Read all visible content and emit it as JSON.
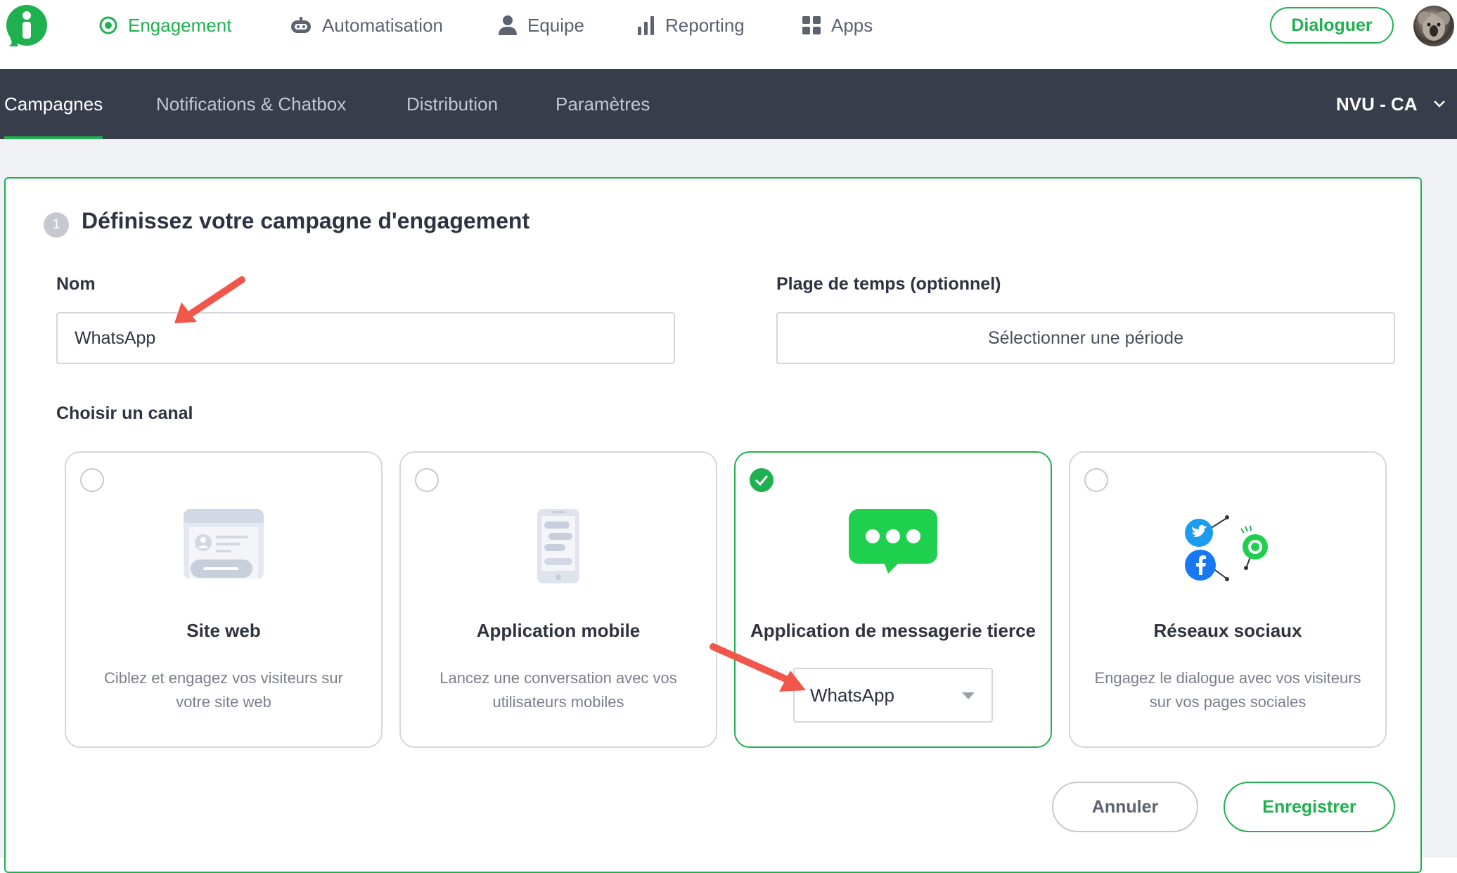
{
  "topnav": {
    "items": [
      {
        "label": "Engagement",
        "icon": "target-icon",
        "active": true
      },
      {
        "label": "Automatisation",
        "icon": "robot-icon",
        "active": false
      },
      {
        "label": "Equipe",
        "icon": "user-icon",
        "active": false
      },
      {
        "label": "Reporting",
        "icon": "bar-chart-icon",
        "active": false
      },
      {
        "label": "Apps",
        "icon": "grid-icon",
        "active": false
      }
    ],
    "cta_label": "Dialoguer"
  },
  "subnav": {
    "tabs": [
      {
        "label": "Campagnes",
        "active": true
      },
      {
        "label": "Notifications & Chatbox",
        "active": false
      },
      {
        "label": "Distribution",
        "active": false
      },
      {
        "label": "Paramètres",
        "active": false
      }
    ],
    "account": "NVU - CA"
  },
  "form": {
    "step_number": "1",
    "title": "Définissez votre campagne d'engagement",
    "name_label": "Nom",
    "name_value": "WhatsApp",
    "period_label": "Plage de temps (optionnel)",
    "period_button": "Sélectionner une période",
    "channel_label": "Choisir un canal",
    "channels": [
      {
        "title": "Site web",
        "description": "Ciblez et engagez vos visiteurs sur votre site web",
        "selected": false,
        "icon": "webpage-icon"
      },
      {
        "title": "Application mobile",
        "description": "Lancez une conversation avec vos utilisateurs mobiles",
        "selected": false,
        "icon": "mobile-phone-icon"
      },
      {
        "title": "Application de messagerie tierce",
        "selected": true,
        "icon": "chat-bubble-icon",
        "select_value": "WhatsApp"
      },
      {
        "title": "Réseaux sociaux",
        "description": "Engagez le dialogue avec vos visiteurs sur vos pages sociales",
        "selected": false,
        "icon": "social-networks-icon"
      }
    ],
    "cancel_label": "Annuler",
    "save_label": "Enregistrer"
  },
  "colors": {
    "accent": "#1fb04f",
    "subnav_bg": "#383d4b",
    "content_bg": "#eff1f5",
    "annotation_arrow": "#f0574a"
  }
}
